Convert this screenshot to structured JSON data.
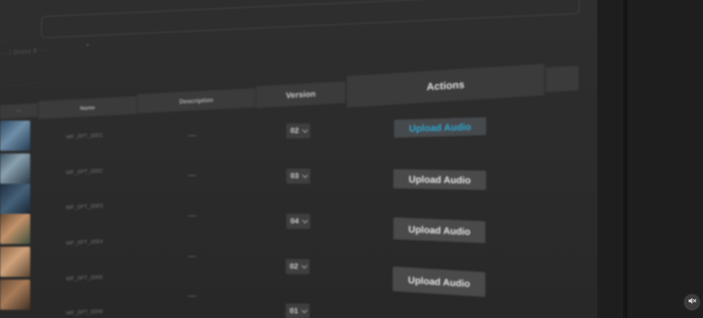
{
  "breadcrumb": {
    "top": "···",
    "path": "··· / Dress 8 - ···",
    "filters": "··· ··· ··· ··· ··· ··· ···"
  },
  "table": {
    "headers": {
      "thumbnail": "···",
      "name": "Name",
      "description": "Description",
      "version": "Version",
      "actions": "Actions"
    },
    "rows": [
      {
        "name": "WF_0PT_0001",
        "description": "—",
        "version": "02",
        "action": "Upload Audio",
        "active": true
      },
      {
        "name": "WF_0PT_0002",
        "description": "—",
        "version": "03",
        "action": "Upload Audio",
        "active": false
      },
      {
        "name": "WF_0PT_0003",
        "description": "—",
        "version": "04",
        "action": "Upload Audio",
        "active": false
      },
      {
        "name": "WF_0PT_0004",
        "description": "—",
        "version": "02",
        "action": "Upload Audio",
        "active": false
      },
      {
        "name": "WF_0PT_0005",
        "description": "—",
        "version": "01",
        "action": "",
        "active": false
      },
      {
        "name": "WF_0PT_0006",
        "description": "",
        "version": "",
        "action": "",
        "active": false
      }
    ]
  },
  "colors": {
    "accent": "#2ea6d1",
    "background": "#2b2b2b",
    "header": "#3b3b3b",
    "button": "#4a4a4a"
  },
  "icons": {
    "mute": "volume-mute-icon",
    "dropdown": "chevron-down-icon"
  }
}
